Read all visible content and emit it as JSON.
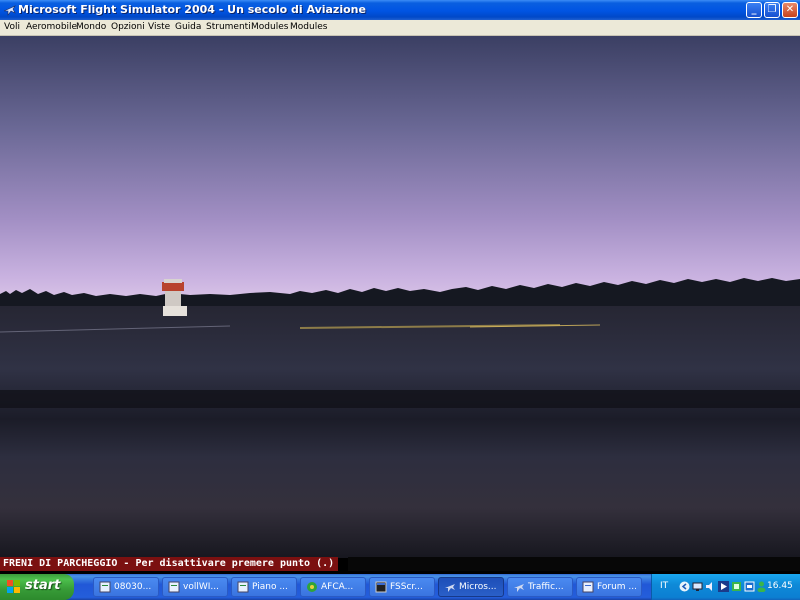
{
  "window": {
    "title": "Microsoft Flight Simulator 2004 - Un secolo di Aviazione",
    "controls": {
      "minimize": "_",
      "maximize": "❐",
      "close": "✕"
    }
  },
  "menubar": {
    "items": [
      "Voli",
      "Aeromobile",
      "Mondo",
      "Opzioni",
      "Viste",
      "Guida",
      "Strumenti",
      "Modules",
      "Modules"
    ]
  },
  "scene": {
    "description_icon": "sunset-runway-view",
    "sky_top_color": "#3c4266",
    "sky_glow_color": "#c4aee0",
    "ground_color": "#2a2b3a"
  },
  "status": {
    "message": "FRENI DI PARCHEGGIO - Per disattivare premere punto (.)",
    "bg_color": "#7b1010"
  },
  "taskbar": {
    "start_label": "start",
    "tasks": [
      {
        "label": "08030...",
        "icon": "document-icon",
        "active": false
      },
      {
        "label": "vollWI...",
        "icon": "document-icon",
        "active": false
      },
      {
        "label": "Piano ...",
        "icon": "document-icon",
        "active": false
      },
      {
        "label": "AFCA...",
        "icon": "app-icon",
        "active": false
      },
      {
        "label": "FSScr...",
        "icon": "window-icon",
        "active": false
      },
      {
        "label": "Micros...",
        "icon": "plane-icon",
        "active": true
      },
      {
        "label": "Traffic...",
        "icon": "plane-icon",
        "active": false
      },
      {
        "label": "Forum ...",
        "icon": "document-icon",
        "active": false
      }
    ],
    "tray": {
      "language": "IT",
      "time": "16.45"
    }
  }
}
